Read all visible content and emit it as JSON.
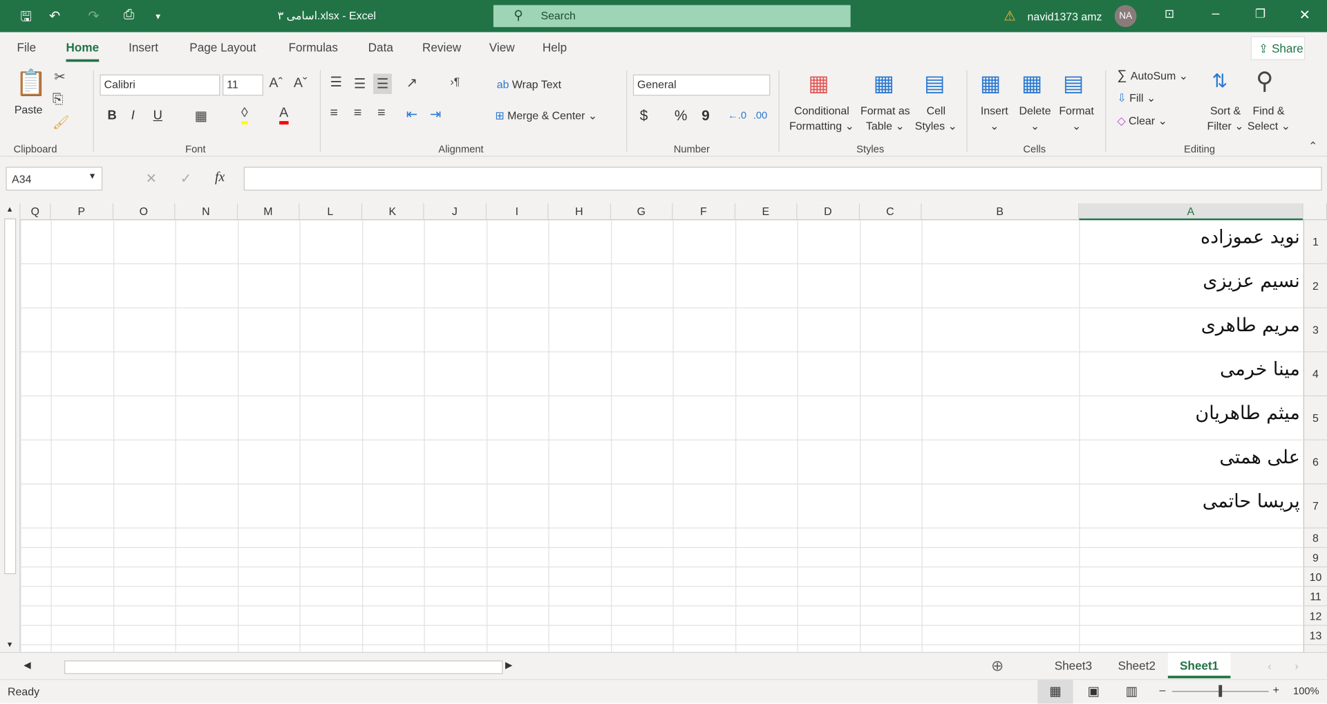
{
  "titlebar": {
    "title": "اسامی ۳.xlsx - Excel",
    "search_placeholder": "Search",
    "user": "navid1373 amz",
    "avatar": "NA"
  },
  "tabs": [
    "File",
    "Home",
    "Insert",
    "Page Layout",
    "Formulas",
    "Data",
    "Review",
    "View",
    "Help"
  ],
  "active_tab": "Home",
  "share": "Share",
  "ribbon": {
    "clipboard": {
      "label": "Clipboard",
      "paste": "Paste"
    },
    "font": {
      "label": "Font",
      "family": "Calibri",
      "size": "11",
      "bold": "B",
      "italic": "I",
      "underline": "U",
      "highlight_color": "#ffff00",
      "font_color": "#ff0000"
    },
    "alignment": {
      "label": "Alignment",
      "wrap": "Wrap Text",
      "merge": "Merge & Center"
    },
    "number": {
      "label": "Number",
      "format": "General",
      "currency": "$",
      "percent": "%",
      "comma": "9"
    },
    "styles": {
      "label": "Styles",
      "conditional": [
        "Conditional",
        "Formatting"
      ],
      "table": [
        "Format as",
        "Table"
      ],
      "cell": [
        "Cell",
        "Styles"
      ]
    },
    "cells": {
      "label": "Cells",
      "insert": "Insert",
      "delete": "Delete",
      "format": "Format"
    },
    "editing": {
      "label": "Editing",
      "autosum": "AutoSum",
      "fill": "Fill",
      "clear": "Clear",
      "sort": [
        "Sort &",
        "Filter"
      ],
      "find": [
        "Find &",
        "Select"
      ]
    }
  },
  "formula_bar": {
    "name_box": "A34",
    "formula": "",
    "fx": "fx"
  },
  "grid": {
    "columns": [
      "A",
      "B",
      "C",
      "D",
      "E",
      "F",
      "G",
      "H",
      "I",
      "J",
      "K",
      "L",
      "M",
      "N",
      "O",
      "P",
      "Q"
    ],
    "selected_column": "A",
    "rows": [
      "1",
      "2",
      "3",
      "4",
      "5",
      "6",
      "7",
      "8",
      "9",
      "10",
      "11",
      "12",
      "13"
    ],
    "cells_A": [
      "نوید عموزاده",
      "نسیم عزیزی",
      "مریم طاهری",
      "مینا خرمی",
      "میثم طاهریان",
      "علی همتی",
      "پریسا حاتمی"
    ]
  },
  "sheets": [
    "Sheet3",
    "Sheet2",
    "Sheet1"
  ],
  "active_sheet": "Sheet1",
  "status": {
    "ready": "Ready",
    "zoom": "100%"
  },
  "accent": "#217346"
}
